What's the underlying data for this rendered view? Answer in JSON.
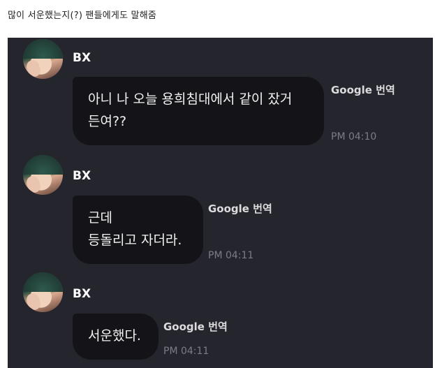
{
  "post": {
    "caption": "많이 서운했는지(?) 팬들에게도 말해줌"
  },
  "messages": [
    {
      "sender": "BX",
      "lines": [
        "아니 나 오늘 용희침대에서 같이 잤거",
        "든여??"
      ],
      "translate_label": "Google 번역",
      "time": "PM 04:10"
    },
    {
      "sender": "BX",
      "lines": [
        "근데",
        "등돌리고 자더라."
      ],
      "translate_label": "Google 번역",
      "time": "PM 04:11"
    },
    {
      "sender": "BX",
      "lines": [
        "서운했다."
      ],
      "translate_label": "Google 번역",
      "time": "PM 04:11"
    }
  ],
  "colors": {
    "chat_background": "#25252e",
    "bubble_background": "#141418",
    "timestamp": "#7c7c86"
  }
}
